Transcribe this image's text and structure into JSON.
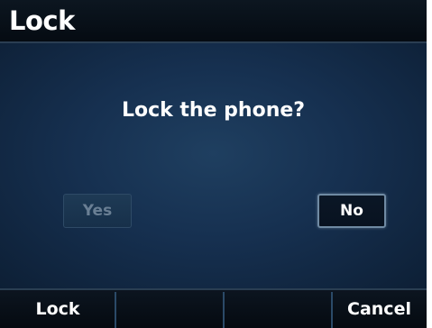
{
  "screen": {
    "title": "Lock"
  },
  "dialog": {
    "prompt": "Lock the phone?",
    "yes_label": "Yes",
    "no_label": "No",
    "selected": "No"
  },
  "softkeys": {
    "key1": "Lock",
    "key2": "",
    "key3": "",
    "key4": "Cancel"
  },
  "colors": {
    "background": "#0a1420",
    "body_center": "#1f3f60",
    "text": "#ffffff",
    "disabled_text": "#6a7f94",
    "divider": "#2b4a68"
  }
}
